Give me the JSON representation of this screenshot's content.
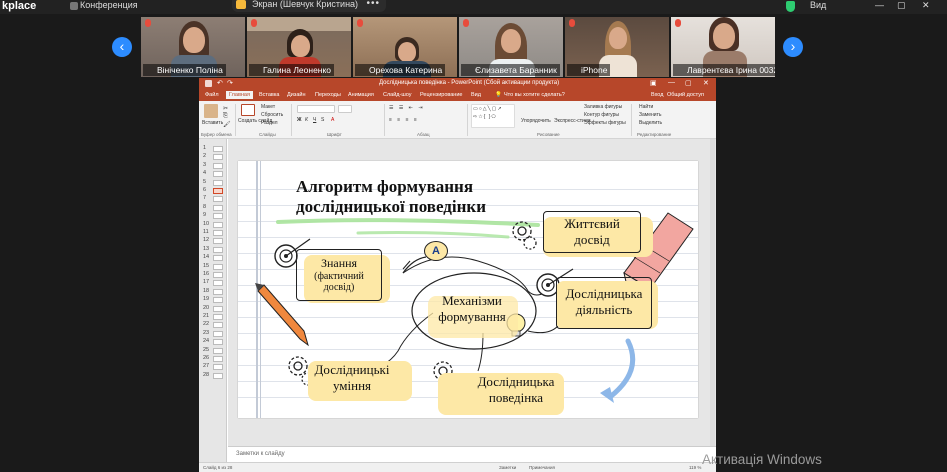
{
  "topbar": {
    "app_name": "kplace",
    "conference_label": "Конференция",
    "screen_share_label": "Экран (Шевчук Кристина)",
    "menu_dots": "•••",
    "right_label": "Вид"
  },
  "participants": [
    {
      "name": "Вініченко Поліна"
    },
    {
      "name": "Галина Леоненко"
    },
    {
      "name": "Орехова Катерина"
    },
    {
      "name": "Єлизавета Баранник"
    },
    {
      "name": "iPhone"
    },
    {
      "name": "Лаврентєва Ірина 0032"
    }
  ],
  "nav": {
    "prev": "‹",
    "next": "›"
  },
  "ppt": {
    "window_title": "Дослідницька поведінка - PowerPoint (Сбой активации продукта)",
    "tabs": [
      "Файл",
      "Главная",
      "Вставка",
      "Дизайн",
      "Переходы",
      "Анимация",
      "Слайд-шоу",
      "Рецензирование",
      "Вид"
    ],
    "tell_me": "Что вы хотите сделать?",
    "sign_in": "Вход",
    "share": "Общий доступ",
    "ribbon": {
      "paste": "Вставить",
      "clipboard_group": "Буфер обмена",
      "create_slide": "Создать слайд",
      "layout": "Макет",
      "reset": "Сбросить",
      "section": "Раздел",
      "slides_group": "Слайды",
      "font_group": "Шрифт",
      "paragraph_group": "Абзац",
      "arrange": "Упорядочить",
      "express_styles": "Экспресс-стили",
      "fill": "Заливка фигуры",
      "outline": "Контур фигуры",
      "effects": "Эффекты фигуры",
      "drawing_group": "Рисование",
      "find": "Найти",
      "replace": "Заменить",
      "select": "Выделить",
      "editing_group": "Редактирование"
    },
    "slide_numbers": [
      "1",
      "2",
      "3",
      "4",
      "5",
      "6",
      "7",
      "8",
      "9",
      "10",
      "11",
      "12",
      "13",
      "14",
      "15",
      "16",
      "17",
      "18",
      "19",
      "20",
      "21",
      "22",
      "23",
      "24",
      "25",
      "26",
      "27",
      "28"
    ],
    "selected_slide": 6,
    "notes_placeholder": "Заметки к слайду",
    "status_left": "Слайд 6 из 28",
    "status_notes": "Заметки",
    "status_comments": "Примечания",
    "zoom": "119 %"
  },
  "slide": {
    "title_line1": "Алгоритм формування",
    "title_line2": "дослідницької поведінки",
    "badge": "A",
    "center_line1": "Механізми",
    "center_line2": "формування",
    "boxes": {
      "knowledge_line1": "Знання",
      "knowledge_line2": "(фактичний",
      "knowledge_line3": "досвід)",
      "life_line1": "Життєвий",
      "life_line2": "досвід",
      "research_activity_line1": "Дослідницька",
      "research_activity_line2": "діяльність",
      "research_skills_line1": "Дослідницькі",
      "research_skills_line2": "уміння",
      "research_behavior_line1": "Дослідницька",
      "research_behavior_line2": "поведінка"
    }
  },
  "watermark": "Активація Windows",
  "colors": {
    "ppt_accent": "#b7472a",
    "zoom_blue": "#2d8cff",
    "highlight_yellow": "#fde8a6"
  }
}
